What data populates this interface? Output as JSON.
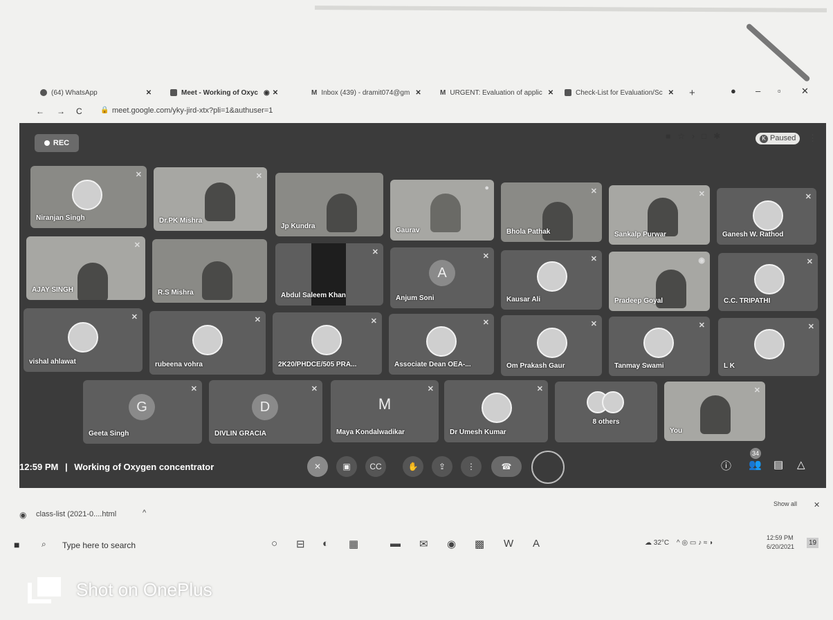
{
  "browser": {
    "tabs": [
      {
        "label": "(64) WhatsApp",
        "icon": "whatsapp-icon"
      },
      {
        "label": "Meet - Working of Oxyc",
        "icon": "meet-icon",
        "active": true,
        "recording": true
      },
      {
        "label": "Inbox (439) - dramit074@gm",
        "icon": "gmail-icon"
      },
      {
        "label": "URGENT: Evaluation of applic",
        "icon": "gmail-icon"
      },
      {
        "label": "Check-List for Evaluation/Sc",
        "icon": "sheets-icon"
      }
    ],
    "new_tab": "+",
    "url": "meet.google.com/yky-jird-xtx?pli=1&authuser=1",
    "profile": "K",
    "sync_status": "Paused"
  },
  "meet": {
    "rec_label": "REC",
    "time": "12:59 PM",
    "separator": "|",
    "meeting_title": "Working of Oxygen concentrator",
    "participant_count": "34",
    "participants": [
      {
        "name": "Niranjan Singh"
      },
      {
        "name": "Dr.PK Mishra"
      },
      {
        "name": "Jp Kundra"
      },
      {
        "name": "Gaurav"
      },
      {
        "name": "Bhola Pathak"
      },
      {
        "name": "Sankalp Purwar"
      },
      {
        "name": "Ganesh W. Rathod"
      },
      {
        "name": "AJAY SINGH"
      },
      {
        "name": "R.S Mishra"
      },
      {
        "name": "Abdul Saleem Khan"
      },
      {
        "name": "Anjum Soni",
        "letter": "A"
      },
      {
        "name": "Kausar Ali"
      },
      {
        "name": "Pradeep Goyal"
      },
      {
        "name": "C.C. TRIPATHI"
      },
      {
        "name": "vishal ahlawat"
      },
      {
        "name": "rubeena vohra"
      },
      {
        "name": "2K20/PHDCE/505 PRA..."
      },
      {
        "name": "Associate Dean OEA-..."
      },
      {
        "name": "Om Prakash Gaur"
      },
      {
        "name": "Tanmay Swami"
      },
      {
        "name": "L K"
      },
      {
        "name": "Geeta Singh",
        "letter": "G"
      },
      {
        "name": "DIVLIN GRACIA",
        "letter": "D"
      },
      {
        "name": "Maya Kondalwadikar",
        "letter": "M"
      },
      {
        "name": "Dr Umesh Kumar"
      },
      {
        "name": "8 others"
      },
      {
        "name": "You"
      }
    ]
  },
  "downloads": {
    "file": "class-list (2021-0....html",
    "show_all": "Show all"
  },
  "taskbar": {
    "search_placeholder": "Type here to search",
    "temperature": "32°C",
    "clock_time": "12:59 PM",
    "clock_date": "6/20/2021",
    "notifications": "19"
  },
  "watermark": "Shot on OnePlus"
}
